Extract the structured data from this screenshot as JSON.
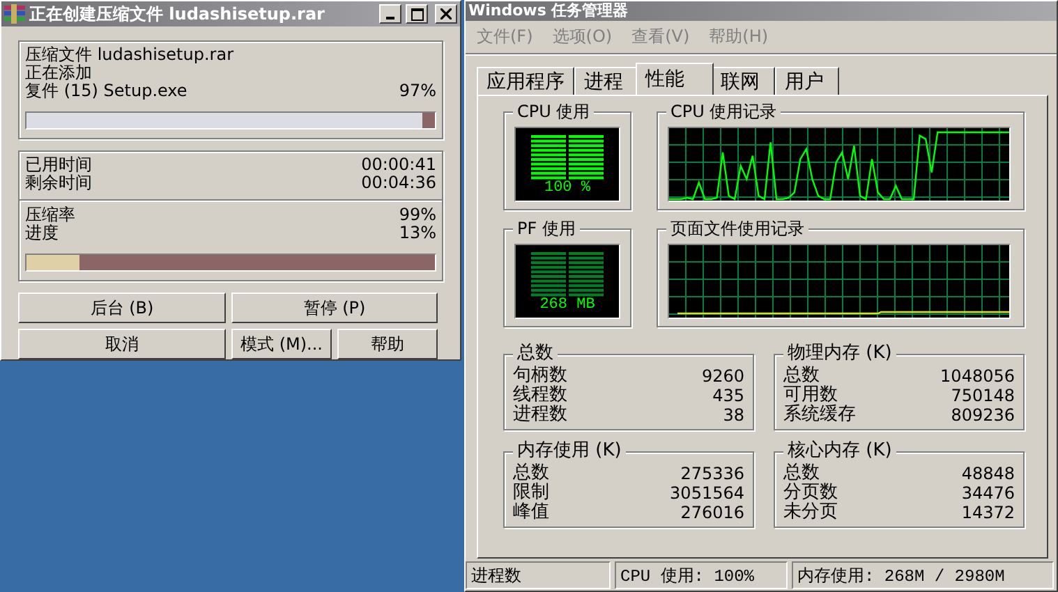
{
  "compress_window": {
    "title": "正在创建压缩文件 ludashisetup.rar",
    "file_lines": [
      "压缩文件 ludashisetup.rar",
      "正在添加"
    ],
    "current_file": {
      "label": "复件 (15) Setup.exe",
      "percent": "97%"
    },
    "file_progress": {
      "level": 0.97
    },
    "time_rows": [
      {
        "label": "已用时间",
        "value": "00:00:41"
      },
      {
        "label": "剩余时间",
        "value": "00:04:36"
      }
    ],
    "stat_rows": [
      {
        "label": "压缩率",
        "value": "99%"
      },
      {
        "label": "进度",
        "value": "13%"
      }
    ],
    "total_progress": {
      "level": 0.13
    },
    "buttons": [
      {
        "label": "后台 (B)"
      },
      {
        "label": "暂停 (P)"
      },
      {
        "label": "取消"
      },
      {
        "label": "模式 (M)..."
      },
      {
        "label": "帮助"
      }
    ]
  },
  "task_manager": {
    "title": "Windows 任务管理器",
    "menu": [
      "文件(F)",
      "选项(O)",
      "查看(V)",
      "帮助(H)"
    ],
    "tabs": [
      {
        "label": "应用程序",
        "selected": false
      },
      {
        "label": "进程",
        "selected": false
      },
      {
        "label": "性能",
        "selected": true
      },
      {
        "label": "联网",
        "selected": false
      },
      {
        "label": "用户",
        "selected": false
      }
    ],
    "cpu_usage": {
      "title": "CPU 使用",
      "reading": "100 %"
    },
    "cpu_history": {
      "title": "CPU 使用记录"
    },
    "pf_usage": {
      "title": "PF 使用",
      "reading": "268 MB"
    },
    "pf_history": {
      "title": "页面文件使用记录"
    },
    "groups": [
      {
        "title": "总数",
        "rows": [
          {
            "label": "句柄数",
            "value": "9260"
          },
          {
            "label": "线程数",
            "value": "435"
          },
          {
            "label": "进程数",
            "value": "38"
          }
        ]
      },
      {
        "title": "物理内存 (K)",
        "rows": [
          {
            "label": "总数",
            "value": "1048056"
          },
          {
            "label": "可用数",
            "value": "750148"
          },
          {
            "label": "系统缓存",
            "value": "809236"
          }
        ]
      },
      {
        "title": "内存使用 (K)",
        "rows": [
          {
            "label": "总数",
            "value": "275336"
          },
          {
            "label": "限制",
            "value": "3051564"
          },
          {
            "label": "峰值",
            "value": "276016"
          }
        ]
      },
      {
        "title": "核心内存 (K)",
        "rows": [
          {
            "label": "总数",
            "value": "48848"
          },
          {
            "label": "分页数",
            "value": "34476"
          },
          {
            "label": "未分页",
            "value": "14372"
          }
        ]
      }
    ],
    "status_bar": [
      "进程数",
      "CPU 使用: 100%",
      "内存使用: 268M / 2980M"
    ]
  }
}
